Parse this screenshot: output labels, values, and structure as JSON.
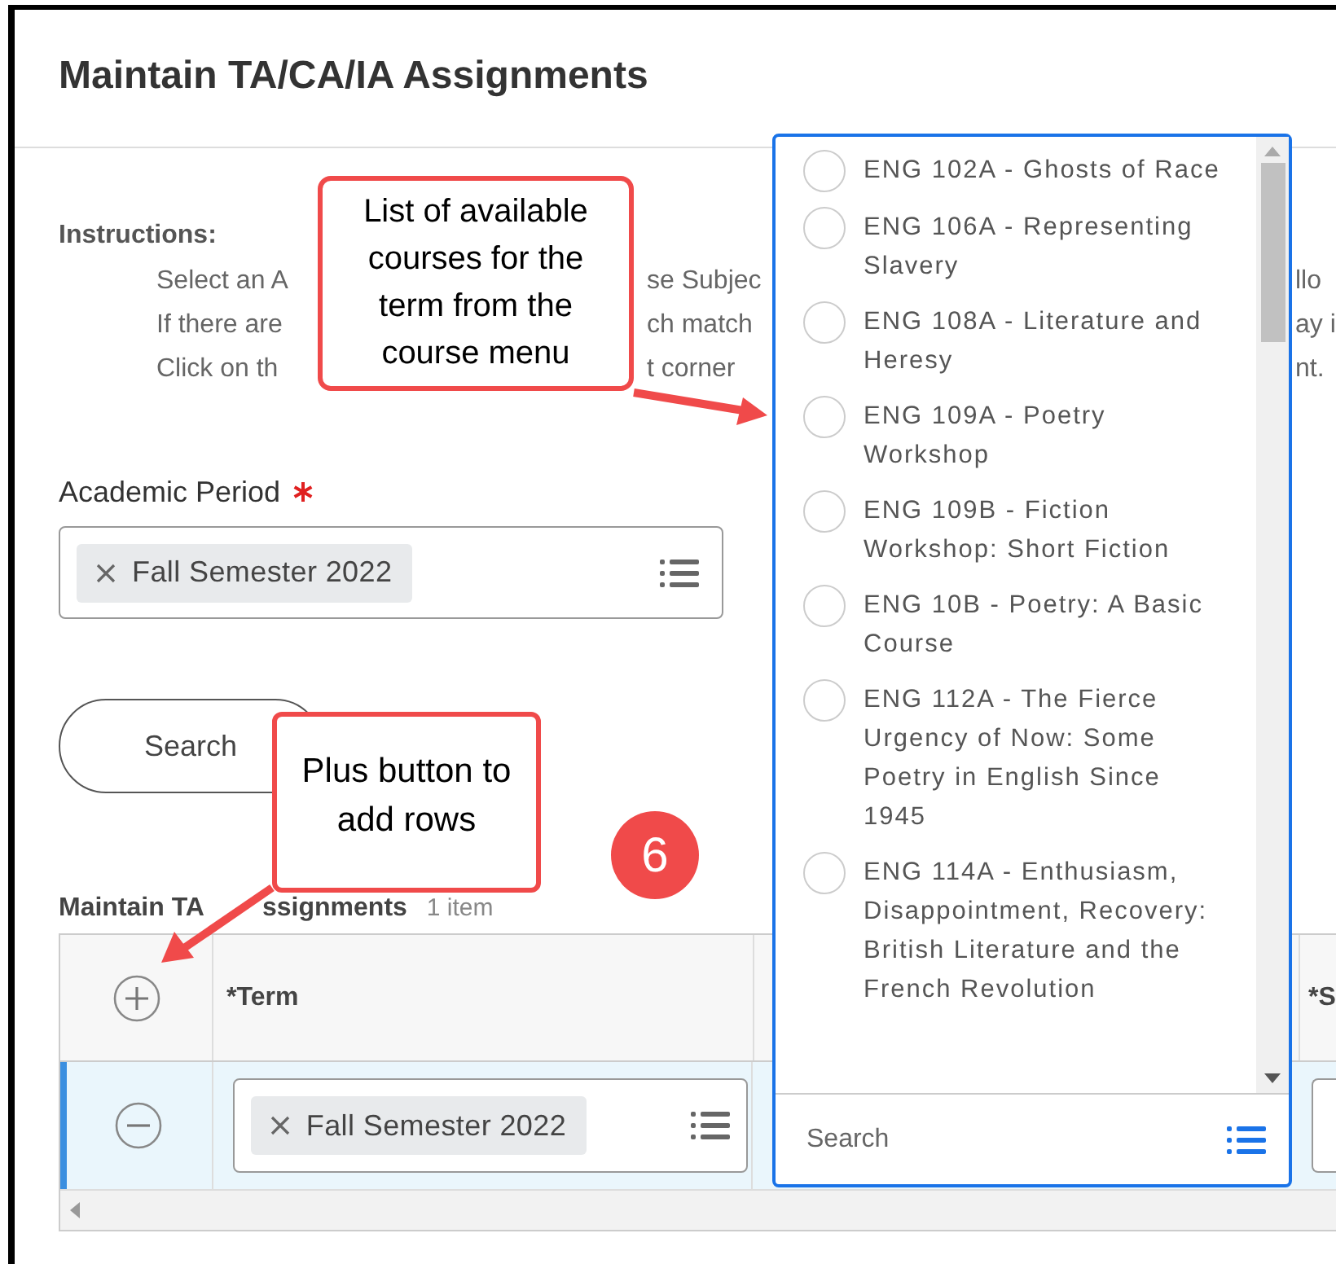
{
  "page": {
    "title": "Maintain TA/CA/IA Assignments"
  },
  "instructions": {
    "heading": "Instructions:",
    "lines": [
      [
        "Select an A",
        "se Subjec",
        "llo"
      ],
      [
        "If there are",
        "ch match",
        "ay i"
      ],
      [
        "Click on th",
        "t corner",
        "nt."
      ]
    ]
  },
  "academic_period": {
    "label": "Academic Period",
    "required": true,
    "value": "Fall Semester 2022"
  },
  "search_button": "Search",
  "assignments": {
    "title_parts": [
      "Maintain TA",
      "ssignments"
    ],
    "count": "1 item",
    "columns": [
      "*Term",
      "*S"
    ],
    "rows": [
      {
        "term": "Fall Semester 2022",
        "selected": true
      }
    ]
  },
  "course_menu": {
    "options": [
      {
        "label": "ENG 102A - Ghosts of Race",
        "selected": false
      },
      {
        "label": "ENG 106A - Representing Slavery",
        "selected": false
      },
      {
        "label": "ENG 108A - Literature and Heresy",
        "selected": false
      },
      {
        "label": "ENG 109A - Poetry Workshop",
        "selected": false
      },
      {
        "label": "ENG 109B - Fiction Workshop: Short Fiction",
        "selected": false
      },
      {
        "label": "ENG 10B - Poetry: A Basic Course",
        "selected": false
      },
      {
        "label": "ENG 112A - The Fierce Urgency of Now: Some Poetry in English Since 1945",
        "selected": false
      },
      {
        "label": "ENG 114A - Enthusiasm, Disappointment, Recovery: British Literature and the French Revolution",
        "selected": false
      }
    ],
    "search_placeholder": "Search"
  },
  "callouts": [
    {
      "text": "List of available courses for the term from the course menu"
    },
    {
      "text": "Plus button to add rows"
    }
  ],
  "step_badge": "6"
}
